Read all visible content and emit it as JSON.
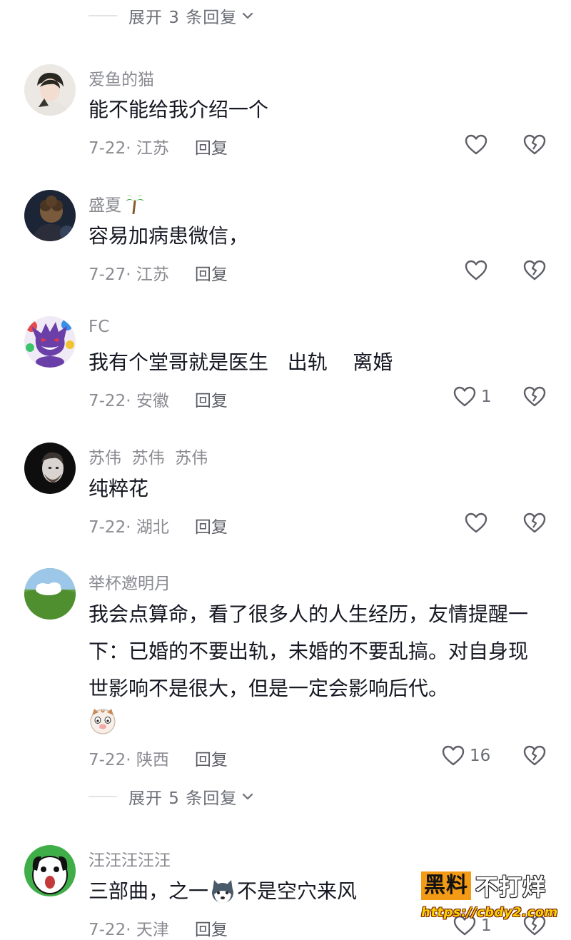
{
  "expand_replies_top": {
    "label": "展开 3 条回复"
  },
  "expand_replies_mid": {
    "label": "展开 5 条回复"
  },
  "comments": [
    {
      "nickname": "爱鱼的猫",
      "text": "能不能给我介绍一个",
      "date_location": "7-22· 江苏",
      "reply_label": "回复",
      "likes": ""
    },
    {
      "nickname": "盛夏",
      "nickname_emoji": "palm-tree",
      "text": "容易加病患微信，",
      "date_location": "7-27· 江苏",
      "reply_label": "回复",
      "likes": ""
    },
    {
      "nickname": "FC",
      "text": "我有个堂哥就是医生   出轨    离婚",
      "date_location": "7-22· 安徽",
      "reply_label": "回复",
      "likes": "1"
    },
    {
      "nickname": "苏伟  苏伟  苏伟",
      "text": "纯粹花",
      "date_location": "7-22· 湖北",
      "reply_label": "回复",
      "likes": ""
    },
    {
      "nickname": "举杯邀明月",
      "text": "我会点算命，看了很多人的人生经历，友情提醒一下：已婚的不要出轨，未婚的不要乱搞。对自身现世影响不是很大，但是一定会影响后代。",
      "text_emoji": "cat-face",
      "date_location": "7-22· 陕西",
      "reply_label": "回复",
      "likes": "16"
    },
    {
      "nickname": "汪汪汪汪汪",
      "text_part1": "三部曲，之一",
      "text_emoji": "husky-face",
      "text_part2": "不是空穴来风",
      "date_location": "7-22· 天津",
      "reply_label": "回复",
      "likes": "1"
    }
  ],
  "watermark": {
    "brand_box": "黑料",
    "brand_text": "不打烊",
    "url": "https://cbdy2.com"
  },
  "colors": {
    "nickname": "#8a8b91",
    "text": "#161823",
    "meta": "#8a8b91",
    "watermark_orange": "#f39a17"
  }
}
